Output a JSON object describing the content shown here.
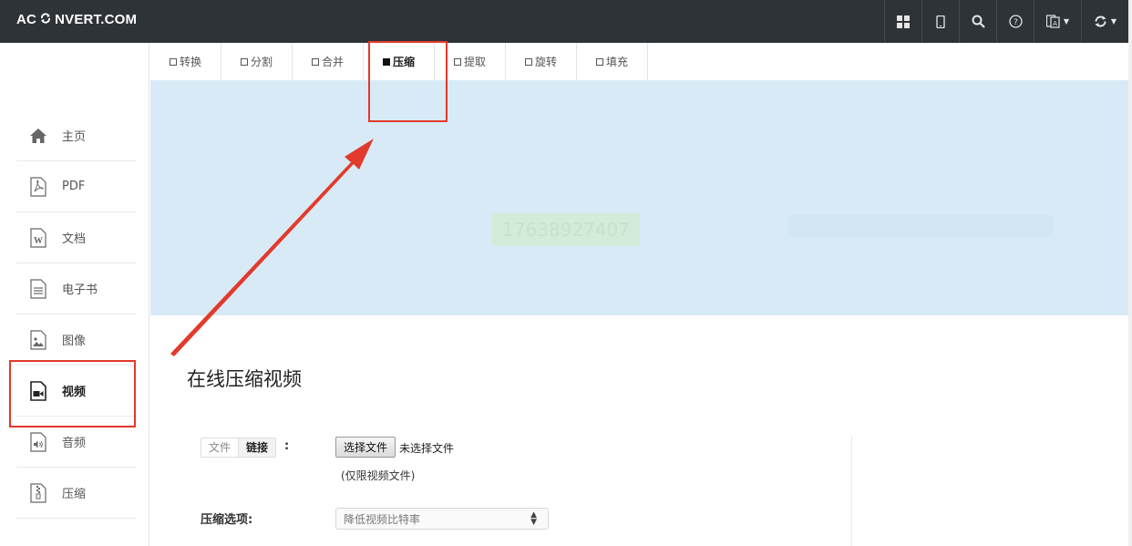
{
  "header": {
    "brand_left": "AC",
    "brand_right": "NVERT.COM",
    "buttons": [
      {
        "icon": "grid-icon"
      },
      {
        "icon": "mobile-icon"
      },
      {
        "icon": "search-icon"
      },
      {
        "icon": "help-icon"
      },
      {
        "icon": "language-icon"
      },
      {
        "icon": "refresh-icon"
      }
    ]
  },
  "sidebar": {
    "items": [
      {
        "label": "主页",
        "icon": "home-icon"
      },
      {
        "label": "PDF",
        "icon": "pdf-file-icon"
      },
      {
        "label": "文档",
        "icon": "word-file-icon"
      },
      {
        "label": "电子书",
        "icon": "ebook-file-icon"
      },
      {
        "label": "图像",
        "icon": "image-file-icon"
      },
      {
        "label": "视频",
        "icon": "video-file-icon",
        "active": true
      },
      {
        "label": "音频",
        "icon": "audio-file-icon"
      },
      {
        "label": "压缩",
        "icon": "archive-file-icon"
      }
    ]
  },
  "tabs": [
    {
      "label": "转换"
    },
    {
      "label": "分割"
    },
    {
      "label": "合并"
    },
    {
      "label": "压缩",
      "active": true
    },
    {
      "label": "提取"
    },
    {
      "label": "旋转"
    },
    {
      "label": "填充"
    }
  ],
  "banner": {
    "faded_text": "17638927407"
  },
  "main": {
    "title": "在线压缩视频",
    "source_options": [
      "文件",
      "链接"
    ],
    "source_active": "链接",
    "colon": ":",
    "file_button": "选择文件",
    "file_status": "未选择文件",
    "file_hint": "(仅限视频文件)",
    "compress_label": "压缩选项:",
    "compress_value": "降低视频比特率"
  },
  "annotation_color": "#e23a2c"
}
